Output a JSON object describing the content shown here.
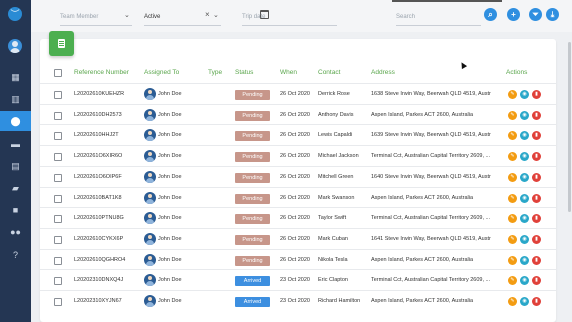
{
  "sidebar": {
    "items": [
      {
        "name": "dashboard-icon",
        "glyph": "▦",
        "active": false
      },
      {
        "name": "map-icon",
        "glyph": "▥",
        "active": false
      },
      {
        "name": "location-pin-icon",
        "glyph": "⬤",
        "active": true
      },
      {
        "name": "car-icon",
        "glyph": "▬",
        "active": false
      },
      {
        "name": "calendar-icon",
        "glyph": "▤",
        "active": false
      },
      {
        "name": "truck-icon",
        "glyph": "▰",
        "active": false
      },
      {
        "name": "briefcase-icon",
        "glyph": "■",
        "active": false
      },
      {
        "name": "users-icon",
        "glyph": "●●",
        "active": false
      },
      {
        "name": "help-icon",
        "glyph": "?",
        "active": false
      }
    ]
  },
  "filters": {
    "team_member_placeholder": "Team Member",
    "status_value": "Active",
    "trip_date_placeholder": "Trip date",
    "search_placeholder": "Search"
  },
  "table": {
    "headers": [
      "Reference Number",
      "Assigned To",
      "Type",
      "Status",
      "When",
      "Contact",
      "Address",
      "Actions"
    ],
    "rows": [
      {
        "ref": "L20202610KUEHZR",
        "assigned": "John Doe",
        "type": "",
        "status": "Pending",
        "when": "26 Oct 2020",
        "contact": "Derrick Rose",
        "address": "1638 Steve Irwin Way, Beerwah QLD 4519, Austr..."
      },
      {
        "ref": "L20202610DH2573",
        "assigned": "John Doe",
        "type": "",
        "status": "Pending",
        "when": "26 Oct 2020",
        "contact": "Anthony Davis",
        "address": "Aspen Island, Parkes ACT 2600, Australia"
      },
      {
        "ref": "L20202610HHJ2T",
        "assigned": "John Doe",
        "type": "",
        "status": "Pending",
        "when": "26 Oct 2020",
        "contact": "Lewis Capaldi",
        "address": "1639 Steve Irwin Way, Beerwah QLD 4519, Austr..."
      },
      {
        "ref": "L2020261O6XIR6O",
        "assigned": "John Doe",
        "type": "",
        "status": "Pending",
        "when": "26 Oct 2020",
        "contact": "Michael Jackson",
        "address": "Terminal Cct, Australian Capital Territory 2609, ..."
      },
      {
        "ref": "L2020261O6OIP6F",
        "assigned": "John Doe",
        "type": "",
        "status": "Pending",
        "when": "26 Oct 2020",
        "contact": "Mitchell Green",
        "address": "1640 Steve Irwin Way, Beerwah QLD 4519, Austr..."
      },
      {
        "ref": "L20202610BAT1K8",
        "assigned": "John Doe",
        "type": "",
        "status": "Pending",
        "when": "26 Oct 2020",
        "contact": "Mark Swanson",
        "address": "Aspen Island, Parkes ACT 2600, Australia"
      },
      {
        "ref": "L20202610PTNU8G",
        "assigned": "John Doe",
        "type": "",
        "status": "Pending",
        "when": "26 Oct 2020",
        "contact": "Taylor Swift",
        "address": "Terminal Cct, Australian Capital Territory 2609, ..."
      },
      {
        "ref": "L20202610CYKX6P",
        "assigned": "John Doe",
        "type": "",
        "status": "Pending",
        "when": "26 Oct 2020",
        "contact": "Mark Cuban",
        "address": "1641 Steve Irwin Way, Beerwah QLD 4519, Austr..."
      },
      {
        "ref": "L20202610QGHRO4",
        "assigned": "John Doe",
        "type": "",
        "status": "Pending",
        "when": "26 Oct 2020",
        "contact": "Nikola Tesla",
        "address": "Aspen Island, Parkes ACT 2600, Australia"
      },
      {
        "ref": "L20202310DNXQ4J",
        "assigned": "John Doe",
        "type": "",
        "status": "Arrived",
        "when": "23 Oct 2020",
        "contact": "Eric Clapton",
        "address": "Terminal Cct, Australian Capital Territory 2609, ..."
      },
      {
        "ref": "L20202310XYJN67",
        "assigned": "John Doe",
        "type": "",
        "status": "Arrived",
        "when": "23 Oct 2020",
        "contact": "Richard Hamilton",
        "address": "Aspen Island, Parkes ACT 2600, Australia"
      }
    ]
  },
  "colors": {
    "pending": "#c7968a",
    "arrived": "#3d8fe0",
    "edit": "#f39c12",
    "view": "#29a7c9",
    "delete": "#e0413a",
    "header_text": "#5aa64c"
  }
}
